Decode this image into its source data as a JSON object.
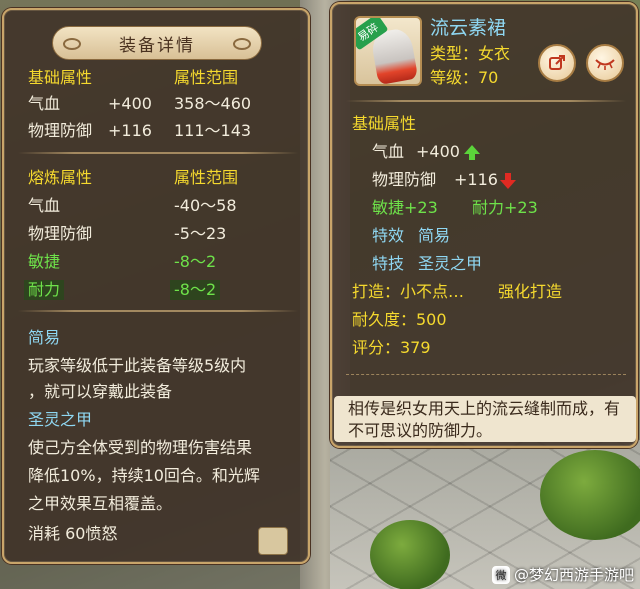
{
  "left_panel": {
    "title": "装备详情",
    "base_section": {
      "header_attr": "基础属性",
      "header_range": "属性范围",
      "rows": [
        {
          "name": "气血",
          "value": "+400",
          "range": "358～460"
        },
        {
          "name": "物理防御",
          "value": "+116",
          "range": "111～143"
        }
      ]
    },
    "refine_section": {
      "header_attr": "熔炼属性",
      "header_range": "属性范围",
      "rows": [
        {
          "name": "气血",
          "range": "-40～58"
        },
        {
          "name": "物理防御",
          "range": "-5～23"
        },
        {
          "name": "敏捷",
          "range": "-8～2"
        },
        {
          "name": "耐力",
          "range": "-8～2"
        }
      ]
    },
    "special_effect": {
      "name": "简易",
      "desc_line1": "玩家等级低于此装备等级5级内",
      "desc_line2": "，就可以穿戴此装备"
    },
    "special_skill": {
      "name": "圣灵之甲",
      "desc_line1": "使己方全体受到的物理伤害结果",
      "desc_line2": "降低10%，持续10回合。和光辉",
      "desc_line3": "之甲效果互相覆盖。",
      "cost": "消耗 60愤怒"
    }
  },
  "right_panel": {
    "item_name": "流云素裙",
    "item_badge": "易碎",
    "type_label": "类型：女衣",
    "level_label": "等级：70",
    "base_header": "基础属性",
    "stats": [
      {
        "name": "气血",
        "value": "+400",
        "trend": "up"
      },
      {
        "name": "物理防御",
        "value": "+116",
        "trend": "down"
      }
    ],
    "bonus_agility": "敏捷+23",
    "bonus_endurance": "耐力+23",
    "effect_label": "特效",
    "effect_value": "简易",
    "skill_label": "特技",
    "skill_value": "圣灵之甲",
    "maker": "打造：小不点…",
    "enhance": "强化打造",
    "durability": "耐久度：500",
    "score": "评分：379",
    "description": "相传是织女用天上的流云缝制而成，有不可思议的防御力。"
  },
  "watermark": "@梦幻西游手游吧",
  "colors": {
    "panel_bg": "#3e3026",
    "panel_border": "#c9a56a",
    "yellow": "#f5d92e",
    "green": "#6ee24a",
    "blue": "#8fd7f2",
    "white": "#f2ecdc"
  },
  "icons": {
    "share": "share-icon",
    "hide": "eye-closed-icon",
    "trend_up": "arrow-up-icon",
    "trend_down": "arrow-down-icon"
  }
}
